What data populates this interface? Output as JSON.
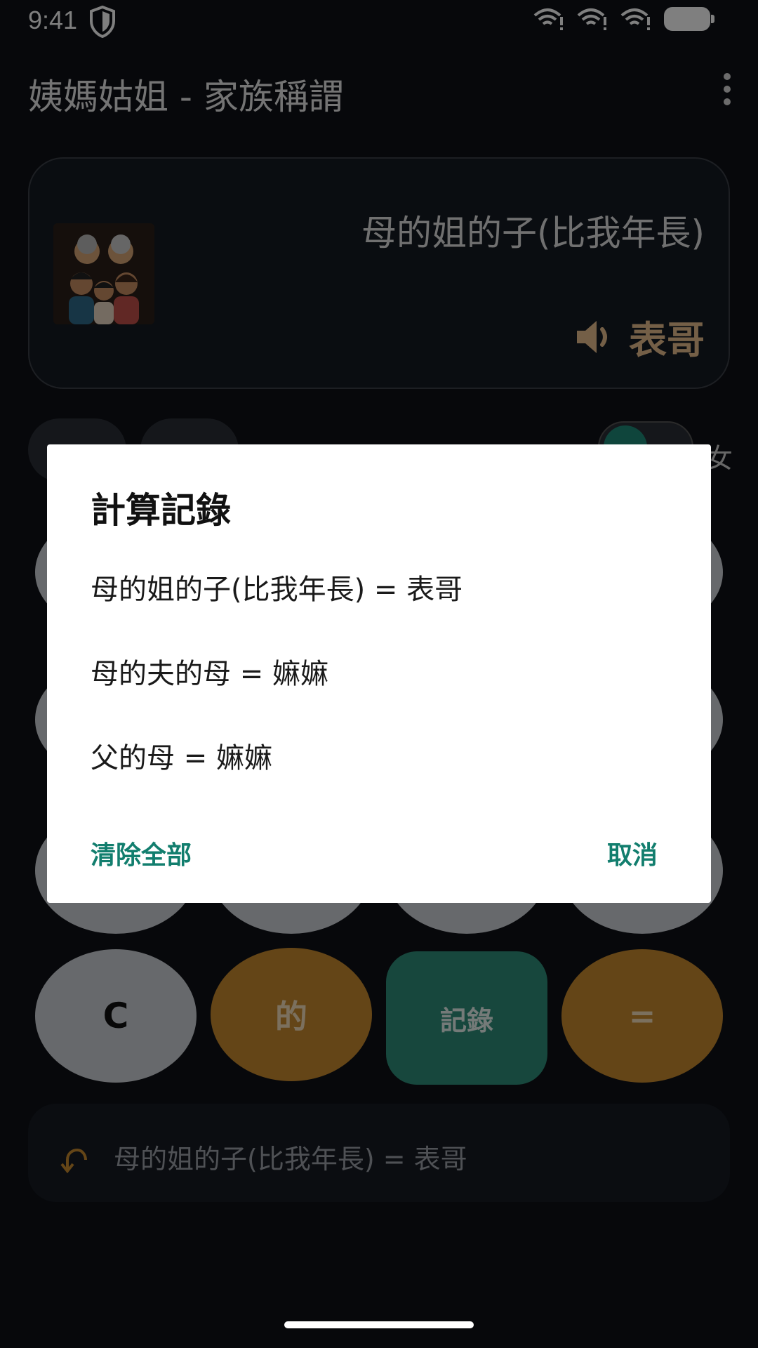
{
  "status_bar": {
    "time": "9:41"
  },
  "app_bar": {
    "title": "姨媽姑姐 - 家族稱謂"
  },
  "display": {
    "expression": "母的姐的子(比我年長)",
    "result": "表哥"
  },
  "keypad": {
    "clear_label": "C",
    "of_label": "的",
    "history_label": "記錄",
    "equals_label": "="
  },
  "history_strip": {
    "text": "母的姐的子(比我年長) = 表哥"
  },
  "dialog": {
    "title": "計算記錄",
    "items": [
      "母的姐的子(比我年長)  =  表哥",
      "母的夫的母  =  嫲嫲",
      "父的母  =  嫲嫲"
    ],
    "clear_all_label": "清除全部",
    "cancel_label": "取消"
  },
  "colors": {
    "accent_teal": "#127e6e",
    "accent_orange": "#c88a2e",
    "background": "#0e1117"
  }
}
